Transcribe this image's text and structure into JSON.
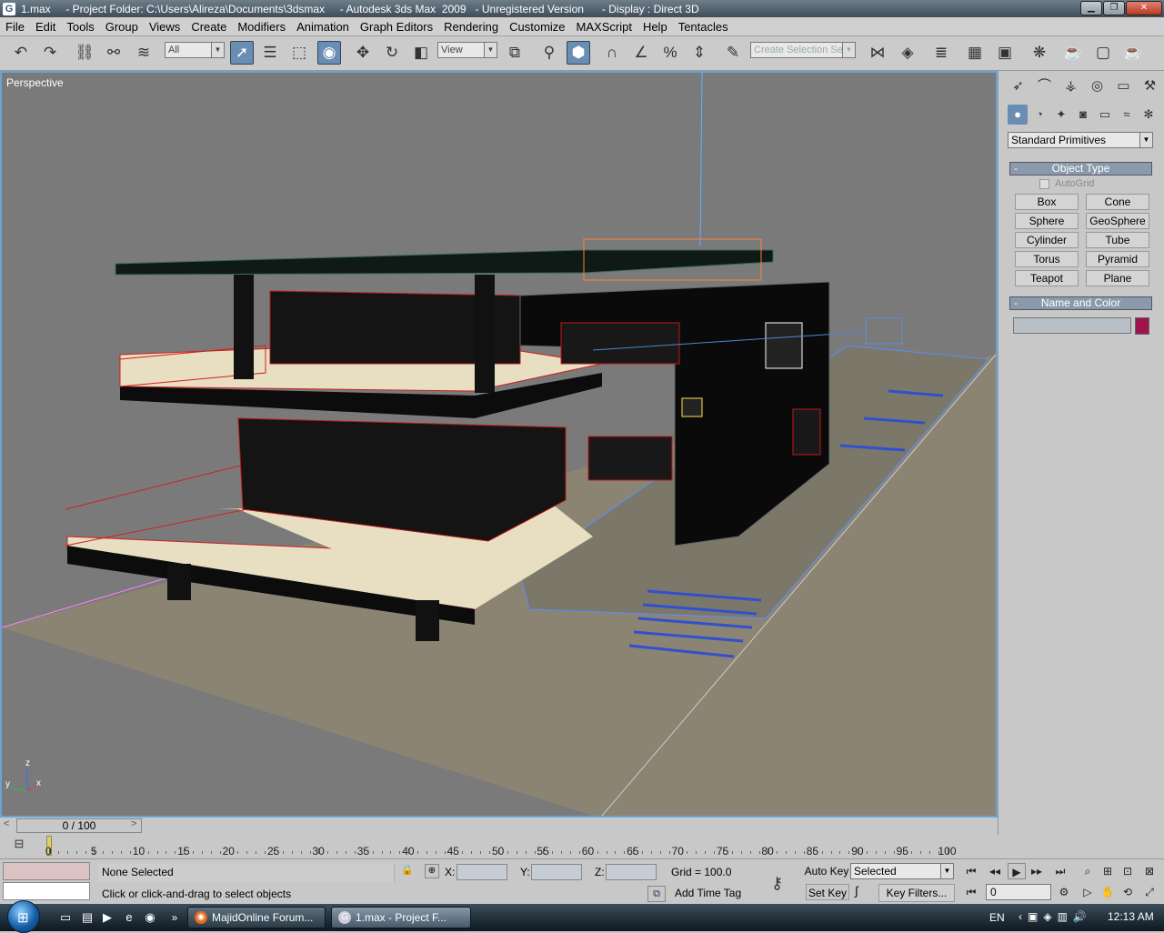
{
  "window": {
    "title": "1.max     - Project Folder: C:\\Users\\Alireza\\Documents\\3dsmax     - Autodesk 3ds Max  2009   - Unregistered Version      - Display : Direct 3D"
  },
  "menu": [
    "File",
    "Edit",
    "Tools",
    "Group",
    "Views",
    "Create",
    "Modifiers",
    "Animation",
    "Graph Editors",
    "Rendering",
    "Customize",
    "MAXScript",
    "Help",
    "Tentacles"
  ],
  "toolbar": {
    "filter_value": "All",
    "coord_system": "View",
    "selection_set_placeholder": "Create Selection Se"
  },
  "viewport": {
    "label": "Perspective",
    "axis_labels": {
      "z": "z",
      "y": "y",
      "x": "x"
    }
  },
  "command_panel": {
    "category": "Standard Primitives",
    "object_type_title": "Object Type",
    "autogrid_label": "AutoGrid",
    "primitives": [
      "Box",
      "Cone",
      "Sphere",
      "GeoSphere",
      "Cylinder",
      "Tube",
      "Torus",
      "Pyramid",
      "Teapot",
      "Plane"
    ],
    "name_color_title": "Name and Color",
    "object_color": "#a0144e",
    "collapse_glyph": "-"
  },
  "timeline": {
    "slider_text": "0 / 100",
    "ticks": [
      "0",
      "5",
      "10",
      "15",
      "20",
      "25",
      "30",
      "35",
      "40",
      "45",
      "50",
      "55",
      "60",
      "65",
      "70",
      "75",
      "80",
      "85",
      "90",
      "95",
      "100"
    ]
  },
  "status": {
    "selection": "None Selected",
    "prompt": "Click or click-and-drag to select objects",
    "x_label": "X:",
    "y_label": "Y:",
    "z_label": "Z:",
    "grid": "Grid = 100.0",
    "add_time_tag": "Add Time Tag",
    "auto_key": "Auto Key",
    "set_key": "Set Key",
    "key_mode": "Selected",
    "key_filters": "Key Filters...",
    "current_frame": "0"
  },
  "taskbar": {
    "tasks": [
      "MajidOnline Forum...",
      "1.max     - Project F..."
    ],
    "language": "EN",
    "clock": "12:13 AM",
    "overflow": "»"
  }
}
